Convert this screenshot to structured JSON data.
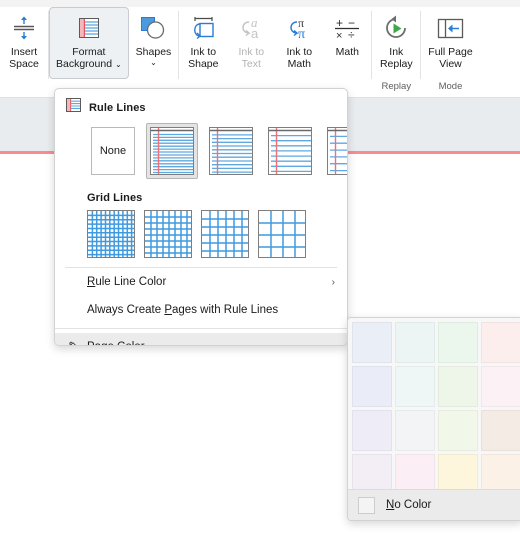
{
  "ribbon": {
    "groups": [
      {
        "name": "group-insert",
        "label": "",
        "buttons": [
          {
            "name": "insert-space-button",
            "label": "Insert\nSpace",
            "icon": "insert-space-icon",
            "selected": false,
            "disabled": false,
            "chevron": false
          }
        ]
      },
      {
        "name": "group-draw-tools",
        "label": "",
        "buttons": [
          {
            "name": "format-background-button",
            "label": "Format\nBackground",
            "icon": "format-background-icon",
            "selected": true,
            "disabled": false,
            "chevron": true
          },
          {
            "name": "shapes-button",
            "label": "Shapes",
            "icon": "shapes-icon",
            "selected": false,
            "disabled": false,
            "chevron": true
          }
        ]
      },
      {
        "name": "group-convert",
        "label": "",
        "buttons": [
          {
            "name": "ink-to-shape-button",
            "label": "Ink to\nShape",
            "icon": "ink-to-shape-icon",
            "selected": false,
            "disabled": false,
            "chevron": false
          },
          {
            "name": "ink-to-text-button",
            "label": "Ink to\nText",
            "icon": "ink-to-text-icon",
            "selected": false,
            "disabled": true,
            "chevron": false
          },
          {
            "name": "ink-to-math-button",
            "label": "Ink to\nMath",
            "icon": "ink-to-math-icon",
            "selected": false,
            "disabled": false,
            "chevron": false
          },
          {
            "name": "math-button",
            "label": "Math",
            "icon": "math-icon",
            "selected": false,
            "disabled": false,
            "chevron": false
          }
        ]
      },
      {
        "name": "group-replay",
        "label": "Replay",
        "buttons": [
          {
            "name": "ink-replay-button",
            "label": "Ink\nReplay",
            "icon": "ink-replay-icon",
            "selected": false,
            "disabled": false,
            "chevron": false
          }
        ]
      },
      {
        "name": "group-mode",
        "label": "Mode",
        "buttons": [
          {
            "name": "full-page-view-button",
            "label": "Full Page\nView",
            "icon": "full-page-view-icon",
            "selected": false,
            "disabled": false,
            "chevron": false
          }
        ]
      }
    ]
  },
  "menu": {
    "rule_lines": {
      "icon": "rule-lines-icon",
      "heading": "Rule Lines",
      "options": [
        {
          "name": "rule-lines-none",
          "label": "None",
          "kind": "none",
          "selected": false
        },
        {
          "name": "rule-lines-narrow-ruled",
          "label": "",
          "kind": "lines",
          "lines": 14,
          "selected": true
        },
        {
          "name": "rule-lines-college-ruled",
          "label": "",
          "kind": "lines",
          "lines": 11,
          "selected": false
        },
        {
          "name": "rule-lines-standard-ruled",
          "label": "",
          "kind": "lines",
          "lines": 8,
          "selected": false
        },
        {
          "name": "rule-lines-wide-ruled",
          "label": "",
          "kind": "lines",
          "lines": 6,
          "selected": false
        }
      ]
    },
    "grid_lines": {
      "heading": "Grid Lines",
      "options": [
        {
          "name": "grid-lines-small",
          "label": "",
          "cells": 11,
          "selected": false
        },
        {
          "name": "grid-lines-medium",
          "label": "",
          "cells": 8,
          "selected": false
        },
        {
          "name": "grid-lines-large",
          "label": "",
          "cells": 6,
          "selected": false
        },
        {
          "name": "grid-lines-very-large",
          "label": "",
          "cells": 4,
          "selected": false
        }
      ]
    },
    "items": [
      {
        "name": "menu-item-rule-line-color",
        "label": "Rule Line Color",
        "accel": "R",
        "submenu": true,
        "icon": null,
        "highlighted": false
      },
      {
        "name": "menu-item-always-create-pages",
        "label": "Always Create Pages with Rule Lines",
        "accel": "P",
        "submenu": false,
        "icon": null,
        "highlighted": false
      },
      {
        "name": "menu-item-page-color",
        "label": "Page Color",
        "accel": "P",
        "submenu": true,
        "icon": "paint-bucket-icon",
        "highlighted": true
      }
    ],
    "submenu_arrow": "›"
  },
  "color_panel": {
    "swatches": [
      [
        "#e9eef7",
        "#ecf5f3",
        "#ebf6ec",
        "#fbeeed",
        "#f2eef7"
      ],
      [
        "#eaecf7",
        "#eef6f6",
        "#eef6ea",
        "#fcf1f4",
        "#f3f0f8"
      ],
      [
        "#eeecf7",
        "#f2f4f6",
        "#f1f7e9",
        "#f3ebe4",
        "#f6f0f7"
      ],
      [
        "#f3edf6",
        "#fbeef5",
        "#fdf6dd",
        "#fbf1e6",
        "#f8eff6"
      ]
    ],
    "no_color_label": "No Color",
    "no_color_accel": "N"
  },
  "colors": {
    "accent_blue": "#2b7cd3",
    "rule_red": "#f98b92",
    "canvas_band": "#e8ecef"
  }
}
